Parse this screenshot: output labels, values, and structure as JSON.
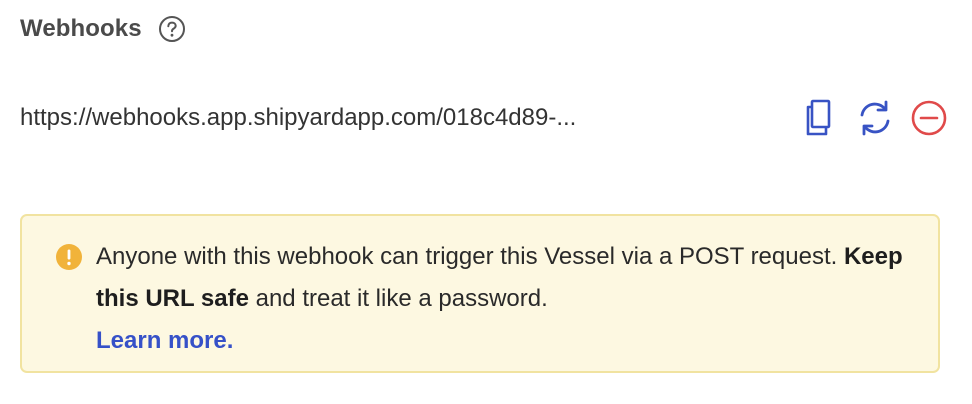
{
  "header": {
    "title": "Webhooks"
  },
  "webhook": {
    "url": "https://webhooks.app.shipyardapp.com/018c4d89-..."
  },
  "warning": {
    "text_before": "Anyone with this webhook can trigger this Vessel via a POST request. ",
    "emphasis": "Keep this URL safe",
    "text_after": " and treat it like a password.",
    "link_label": "Learn more."
  },
  "icons": {
    "help": "question-circle-icon",
    "copy": "copy-icon",
    "regenerate": "refresh-icon",
    "remove": "minus-circle-icon",
    "warning": "exclamation-circle-icon"
  },
  "colors": {
    "action_blue": "#3853c4",
    "danger_red": "#e04a4a",
    "warning_amber": "#f1b33a",
    "warning_bg": "#fdf8e1",
    "warning_border": "#f1e3a0",
    "link_blue": "#3651c8"
  }
}
